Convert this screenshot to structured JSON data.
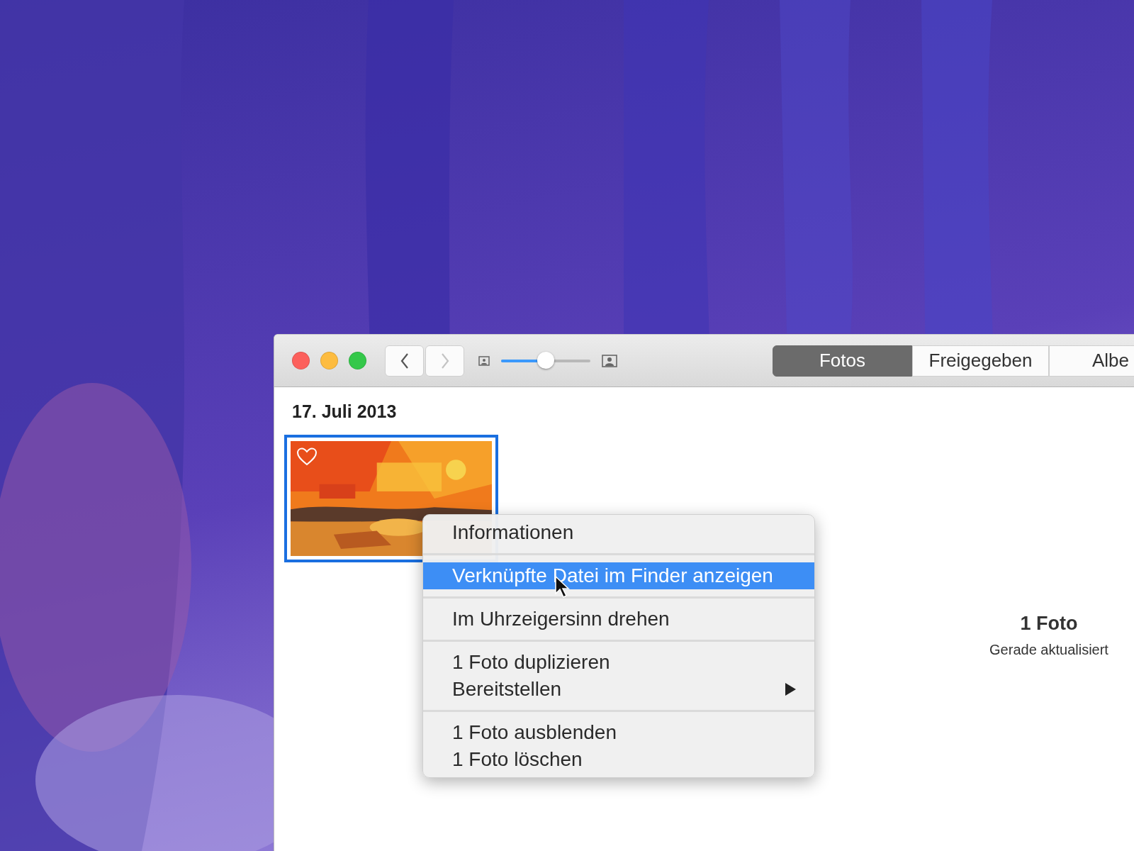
{
  "window": {
    "toolbar": {
      "traffic_lights": [
        {
          "color": "#fc605c"
        },
        {
          "color": "#fdbc40"
        },
        {
          "color": "#34c84a"
        }
      ],
      "navigation": [
        {
          "kind": "back",
          "disabled": false
        },
        {
          "kind": "forward",
          "disabled": true
        }
      ],
      "size_slider": {
        "level": 0.5
      },
      "tabs": [
        {
          "label": "Fotos",
          "selected": true
        },
        {
          "label": "Freigegeben",
          "selected": false
        },
        {
          "label": "Albe",
          "selected": false
        }
      ]
    },
    "content": {
      "date_header": "17. Juli 2013",
      "photos": [
        {
          "kind": "picture",
          "favorite": true,
          "selected": true
        }
      ],
      "summary": {
        "count": "1 Foto",
        "status": "Gerade aktualisiert"
      }
    }
  },
  "context_menu": {
    "groups": [
      [
        {
          "label": "Informationen",
          "selected": false,
          "submenu": false
        }
      ],
      [
        {
          "label": "Verknüpfte Datei im Finder anzeigen",
          "selected": true,
          "submenu": false
        }
      ],
      [
        {
          "label": "Im Uhrzeigersinn drehen",
          "selected": false,
          "submenu": false
        }
      ],
      [
        {
          "label": "1 Foto duplizieren",
          "selected": false,
          "submenu": false
        },
        {
          "label": "Bereitstellen",
          "selected": false,
          "submenu": true
        }
      ],
      [
        {
          "label": "1 Foto ausblenden",
          "selected": false,
          "submenu": false
        },
        {
          "label": "1 Foto löschen",
          "selected": false,
          "submenu": false
        }
      ]
    ]
  }
}
